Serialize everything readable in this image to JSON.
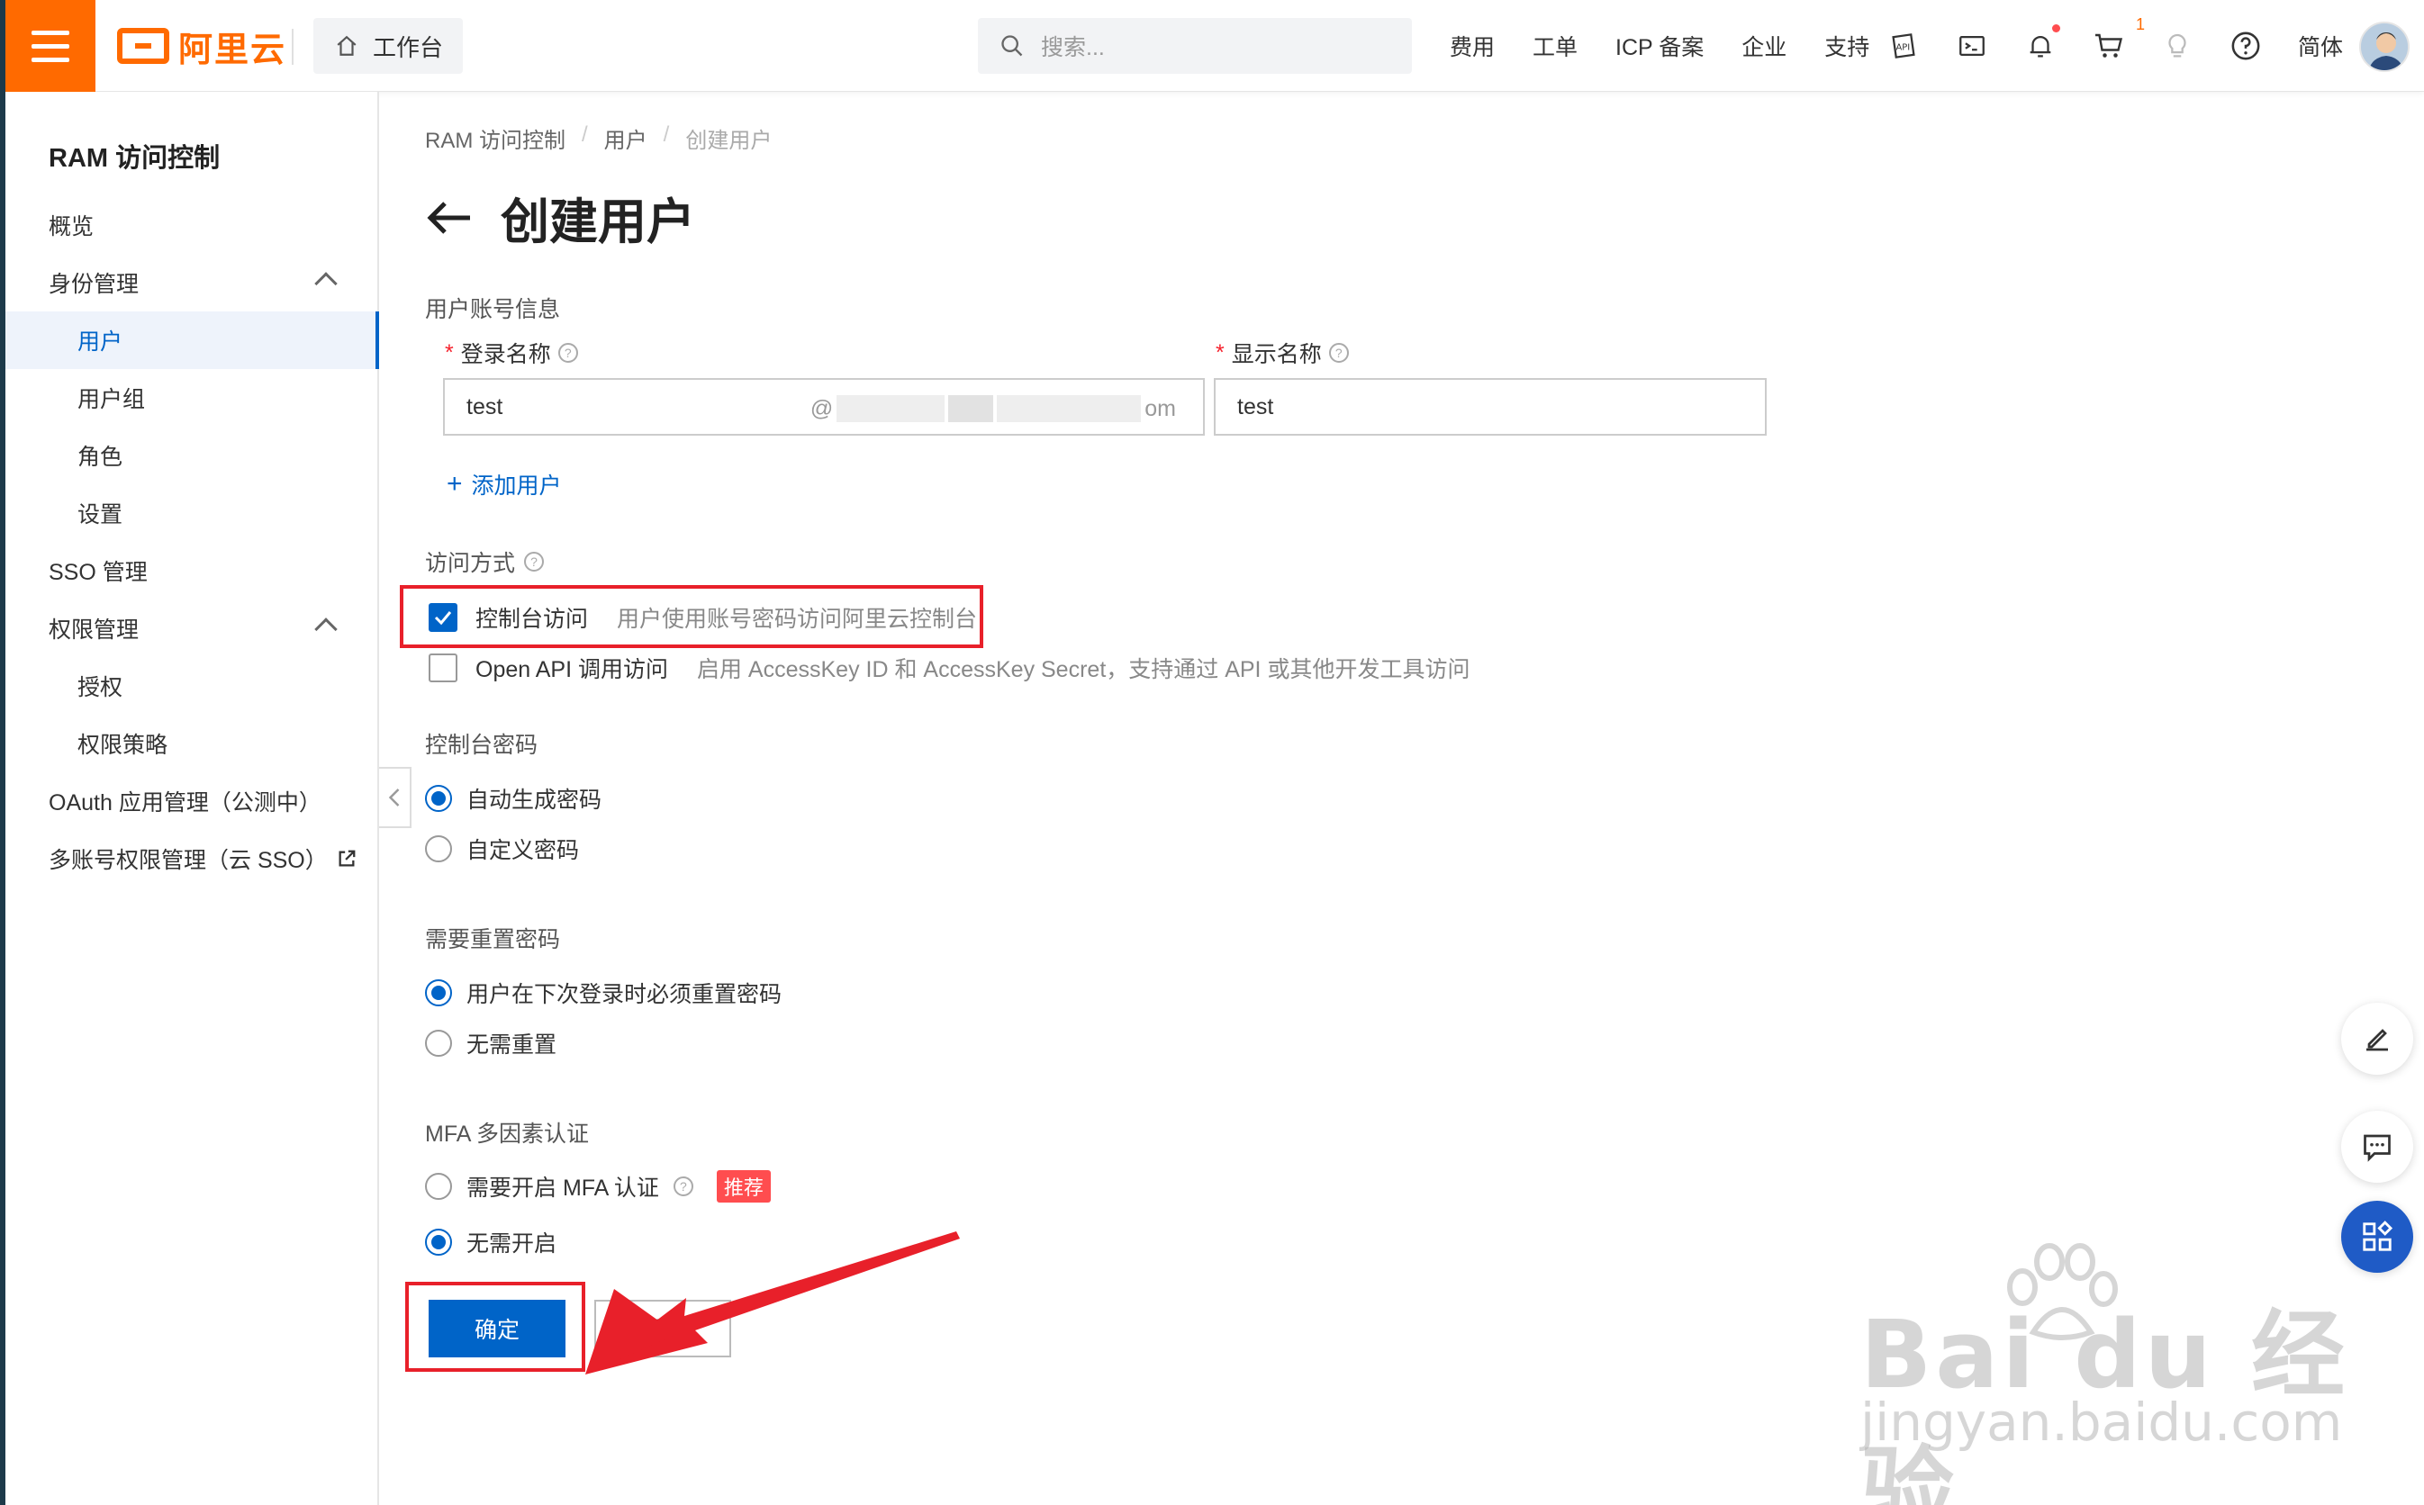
{
  "topbar": {
    "brand": "阿里云",
    "workbench": "工作台",
    "search_placeholder": "搜索...",
    "links": [
      "费用",
      "工单",
      "ICP 备案",
      "企业",
      "支持"
    ],
    "cart_count": "1",
    "lang": "简体"
  },
  "sidebar": {
    "title": "RAM 访问控制",
    "items": [
      {
        "label": "概览"
      },
      {
        "label": "身份管理"
      },
      {
        "label": "用户"
      },
      {
        "label": "用户组"
      },
      {
        "label": "角色"
      },
      {
        "label": "设置"
      },
      {
        "label": "SSO 管理"
      },
      {
        "label": "权限管理"
      },
      {
        "label": "授权"
      },
      {
        "label": "权限策略"
      },
      {
        "label": "OAuth 应用管理（公测中）"
      },
      {
        "label": "多账号权限管理（云 SSO）"
      }
    ]
  },
  "breadcrumb": [
    "RAM 访问控制",
    "用户",
    "创建用户"
  ],
  "page_title": "创建用户",
  "form": {
    "account_section": "用户账号信息",
    "login_name_label": "登录名称",
    "login_name_value": "test",
    "login_suffix_start": "@",
    "login_suffix_end": "om",
    "display_name_label": "显示名称",
    "display_name_value": "test",
    "add_user": "添加用户",
    "access_section": "访问方式",
    "console_access": "控制台访问",
    "console_access_desc": "用户使用账号密码访问阿里云控制台",
    "api_access": "Open API 调用访问",
    "api_access_desc": "启用 AccessKey ID 和 AccessKey Secret，支持通过 API 或其他开发工具访问",
    "password_section": "控制台密码",
    "auto_password": "自动生成密码",
    "custom_password": "自定义密码",
    "reset_section": "需要重置密码",
    "reset_required": "用户在下次登录时必须重置密码",
    "reset_not_required": "无需重置",
    "mfa_section": "MFA 多因素认证",
    "mfa_required": "需要开启 MFA 认证",
    "mfa_tag": "推荐",
    "mfa_not_required": "无需开启",
    "confirm": "确定",
    "back": "返回"
  },
  "watermark": {
    "main": "Bai du 经验",
    "url": "jingyan.baidu.com"
  },
  "colors": {
    "brand": "#ff6a00",
    "primary": "#0064c8",
    "highlight": "#e8202a"
  }
}
